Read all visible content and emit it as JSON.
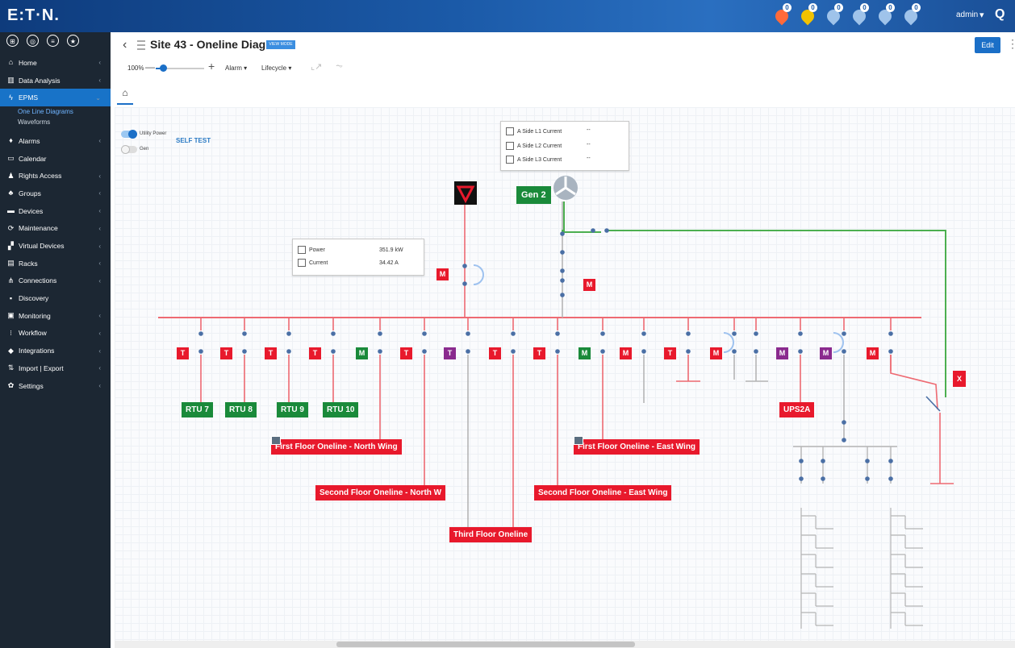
{
  "app": {
    "logo": "E:T·N.",
    "user": "admin",
    "notification_badges": [
      "0",
      "0",
      "0",
      "0",
      "0",
      "0"
    ]
  },
  "colors": {
    "accent": "#1b6fc7",
    "sidebar_bg": "#1c2733",
    "red": "#e8192c",
    "green": "#1a8a3a",
    "purple": "#8a2a8e",
    "gen_line": "#4caf50",
    "bus_line": "#ee6a72"
  },
  "sidebar": {
    "items": [
      {
        "label": "Home",
        "icon": "home-icon",
        "glyph": "⌂",
        "chevron": "‹"
      },
      {
        "label": "Data Analysis",
        "icon": "chart-icon",
        "glyph": "▥",
        "chevron": "‹"
      },
      {
        "label": "EPMS",
        "icon": "bolt-icon",
        "glyph": "ϟ",
        "chevron": "⌄",
        "active": true
      },
      {
        "label": "Alarms",
        "icon": "bell-icon",
        "glyph": "♦",
        "chevron": "‹"
      },
      {
        "label": "Calendar",
        "icon": "calendar-icon",
        "glyph": "▭",
        "chevron": ""
      },
      {
        "label": "Rights Access",
        "icon": "user-key-icon",
        "glyph": "♟",
        "chevron": "‹"
      },
      {
        "label": "Groups",
        "icon": "groups-icon",
        "glyph": "♣",
        "chevron": "‹"
      },
      {
        "label": "Devices",
        "icon": "devices-icon",
        "glyph": "▬",
        "chevron": "‹"
      },
      {
        "label": "Maintenance",
        "icon": "maintenance-icon",
        "glyph": "⟳",
        "chevron": "‹"
      },
      {
        "label": "Virtual Devices",
        "icon": "virtual-devices-icon",
        "glyph": "▞",
        "chevron": "‹"
      },
      {
        "label": "Racks",
        "icon": "racks-icon",
        "glyph": "▤",
        "chevron": "‹"
      },
      {
        "label": "Connections",
        "icon": "connections-icon",
        "glyph": "⋔",
        "chevron": "‹"
      },
      {
        "label": "Discovery",
        "icon": "discovery-icon",
        "glyph": "▪",
        "chevron": ""
      },
      {
        "label": "Monitoring",
        "icon": "monitoring-icon",
        "glyph": "▣",
        "chevron": "‹"
      },
      {
        "label": "Workflow",
        "icon": "workflow-icon",
        "glyph": "⁝",
        "chevron": "‹"
      },
      {
        "label": "Integrations",
        "icon": "integrations-icon",
        "glyph": "◆",
        "chevron": "‹"
      },
      {
        "label": "Import | Export",
        "icon": "import-export-icon",
        "glyph": "⇅",
        "chevron": "‹"
      },
      {
        "label": "Settings",
        "icon": "settings-icon",
        "glyph": "✿",
        "chevron": "‹"
      }
    ],
    "epms_sub": [
      "One Line Diagrams",
      "Waveforms"
    ]
  },
  "header": {
    "title": "Site 43 - Oneline Diagram",
    "badge": "VIEW MODE",
    "edit": "Edit"
  },
  "toolbar": {
    "zoom": "100%",
    "zoom_level": 0.15,
    "alarm": "Alarm ▾",
    "lifecycle": "Lifecycle ▾"
  },
  "toggles": {
    "utility_power": "Utility Power",
    "gen": "Gen",
    "self_test": "SELF TEST"
  },
  "power_box": {
    "power_label": "Power",
    "power_value": "351.9 kW",
    "current_label": "Current",
    "current_value": "34.42 A"
  },
  "current_box": {
    "rows": [
      {
        "label": "A Side L1 Current",
        "value": "--"
      },
      {
        "label": "A Side L2 Current",
        "value": "--"
      },
      {
        "label": "A Side L3 Current",
        "value": "--"
      }
    ]
  },
  "diagram": {
    "gen": "Gen 2",
    "breaker_labels": [
      "T",
      "T",
      "T",
      "T",
      "M",
      "T",
      "T",
      "T",
      "T",
      "M",
      "M",
      "T",
      "M",
      "M",
      "M",
      "M"
    ],
    "main_m": "M",
    "gen_m": "M",
    "x_box": "X",
    "rtu": [
      "RTU 7",
      "RTU 8",
      "RTU 9",
      "RTU 10"
    ],
    "ups": "UPS2A",
    "floors": {
      "first_north": "First Floor Oneline - North Wing",
      "second_north": "Second Floor Oneline - North W",
      "third": "Third Floor Oneline",
      "second_east": "Second Floor Oneline - East Wing",
      "first_east": "First Floor Oneline - East Wing"
    }
  }
}
